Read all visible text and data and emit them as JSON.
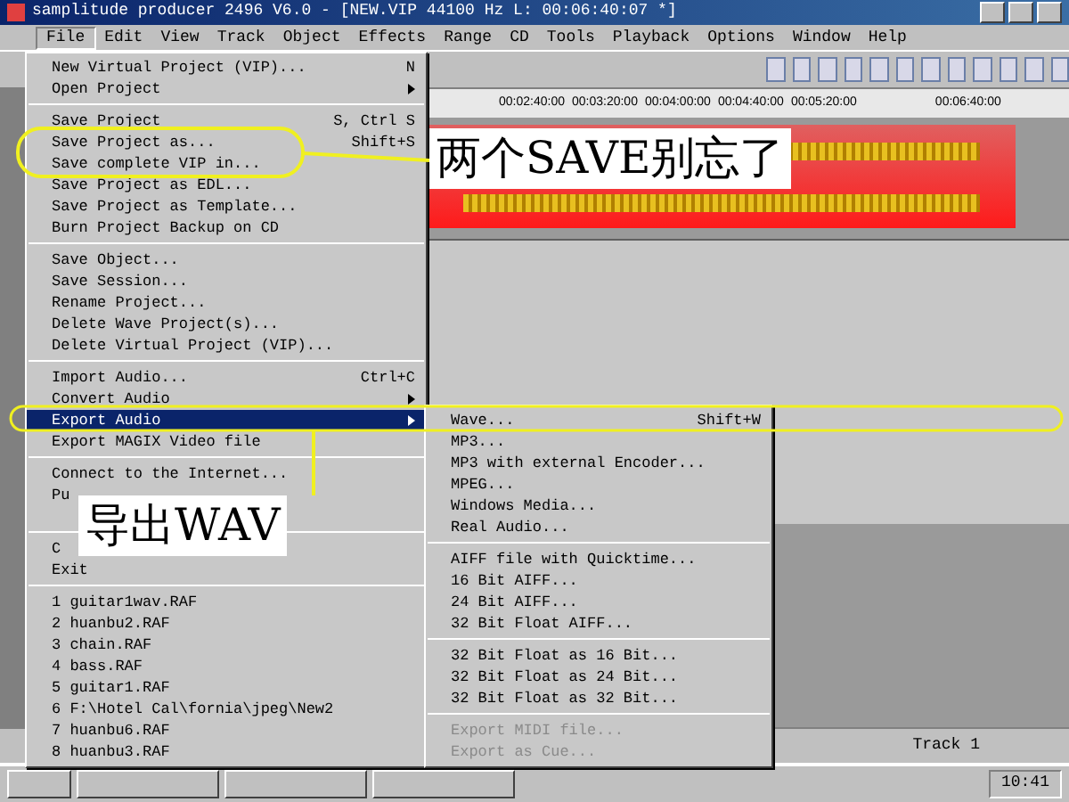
{
  "window": {
    "title": "samplitude producer 2496 V6.0 - [NEW.VIP  44100 Hz L: 00:06:40:07 *]"
  },
  "menu_bar": [
    {
      "label": "File",
      "selected": true
    },
    {
      "label": "Edit",
      "selected": false
    },
    {
      "label": "View",
      "selected": false
    },
    {
      "label": "Track",
      "selected": false
    },
    {
      "label": "Object",
      "selected": false
    },
    {
      "label": "Effects",
      "selected": false
    },
    {
      "label": "Range",
      "selected": false
    },
    {
      "label": "CD",
      "selected": false
    },
    {
      "label": "Tools",
      "selected": false
    },
    {
      "label": "Playback",
      "selected": false
    },
    {
      "label": "Options",
      "selected": false
    },
    {
      "label": "Window",
      "selected": false
    },
    {
      "label": "Help",
      "selected": false
    }
  ],
  "ruler": [
    "00:02:40:00",
    "00:03:20:00",
    "00:04:00:00",
    "00:04:40:00",
    "00:05:20:00",
    "00:06:40:00"
  ],
  "file_menu": [
    {
      "kind": "item",
      "label": "New Virtual Project (VIP)...",
      "shortcut": "N"
    },
    {
      "kind": "item",
      "label": "Open Project",
      "submenu": true
    },
    {
      "kind": "separator"
    },
    {
      "kind": "item",
      "label": "Save Project",
      "shortcut": "S, Ctrl S"
    },
    {
      "kind": "item",
      "label": "Save Project as...",
      "shortcut": "Shift+S"
    },
    {
      "kind": "item",
      "label": "Save complete VIP in..."
    },
    {
      "kind": "item",
      "label": "Save Project as EDL..."
    },
    {
      "kind": "item",
      "label": "Save Project as Template..."
    },
    {
      "kind": "item",
      "label": "Burn Project Backup on CD"
    },
    {
      "kind": "separator"
    },
    {
      "kind": "item",
      "label": "Save Object..."
    },
    {
      "kind": "item",
      "label": "Save Session..."
    },
    {
      "kind": "item",
      "label": "Rename Project..."
    },
    {
      "kind": "item",
      "label": "Delete Wave Project(s)..."
    },
    {
      "kind": "item",
      "label": "Delete Virtual Project (VIP)..."
    },
    {
      "kind": "separator"
    },
    {
      "kind": "item",
      "label": "Import Audio...",
      "shortcut": "Ctrl+C"
    },
    {
      "kind": "item",
      "label": "Convert Audio",
      "submenu": true
    },
    {
      "kind": "item",
      "label": "Export Audio",
      "submenu": true,
      "selected": true
    },
    {
      "kind": "item",
      "label": "Export MAGIX Video file"
    },
    {
      "kind": "separator"
    },
    {
      "kind": "item",
      "label": "Connect to the Internet..."
    },
    {
      "kind": "item",
      "label": "Pu"
    },
    {
      "kind": "blank"
    },
    {
      "kind": "separator"
    },
    {
      "kind": "item",
      "label": "C"
    },
    {
      "kind": "item",
      "label": "Exit"
    },
    {
      "kind": "separator"
    },
    {
      "kind": "item",
      "label": "1 guitar1wav.RAF"
    },
    {
      "kind": "item",
      "label": "2 huanbu2.RAF"
    },
    {
      "kind": "item",
      "label": "3 chain.RAF"
    },
    {
      "kind": "item",
      "label": "4 bass.RAF"
    },
    {
      "kind": "item",
      "label": "5 guitar1.RAF"
    },
    {
      "kind": "item",
      "label": "6 F:\\Hotel Cal\\fornia\\jpeg\\New2"
    },
    {
      "kind": "item",
      "label": "7 huanbu6.RAF"
    },
    {
      "kind": "item",
      "label": "8 huanbu3.RAF"
    }
  ],
  "export_submenu": [
    {
      "kind": "item",
      "label": "Wave...",
      "shortcut": "Shift+W"
    },
    {
      "kind": "item",
      "label": "MP3..."
    },
    {
      "kind": "item",
      "label": "MP3 with external Encoder..."
    },
    {
      "kind": "item",
      "label": "MPEG..."
    },
    {
      "kind": "item",
      "label": "Windows Media..."
    },
    {
      "kind": "item",
      "label": "Real Audio..."
    },
    {
      "kind": "separator"
    },
    {
      "kind": "item",
      "label": "AIFF file with Quicktime..."
    },
    {
      "kind": "item",
      "label": "16 Bit AIFF..."
    },
    {
      "kind": "item",
      "label": "24 Bit AIFF..."
    },
    {
      "kind": "item",
      "label": "32 Bit Float AIFF..."
    },
    {
      "kind": "separator"
    },
    {
      "kind": "item",
      "label": "32 Bit Float as 16 Bit..."
    },
    {
      "kind": "item",
      "label": "32 Bit Float as 24 Bit..."
    },
    {
      "kind": "item",
      "label": "32 Bit Float as 32 Bit..."
    },
    {
      "kind": "separator"
    },
    {
      "kind": "item",
      "label": "Export MIDI file...",
      "disabled": true
    },
    {
      "kind": "item",
      "label": "Export as Cue...",
      "disabled": true
    }
  ],
  "annotations": [
    {
      "text": "两个SAVE别忘了"
    },
    {
      "text": "导出WAV"
    }
  ],
  "status_bar": {
    "track": "Track 1"
  },
  "taskbar": {
    "clock": "10:41"
  }
}
